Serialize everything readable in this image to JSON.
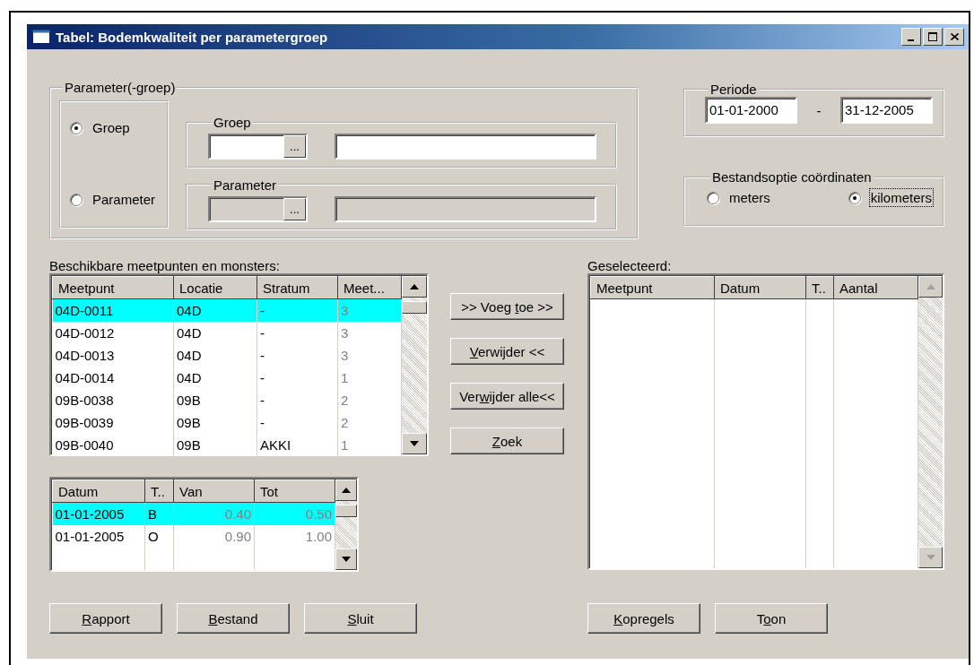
{
  "window": {
    "title": "Tabel: Bodemkwaliteit per parametergroep"
  },
  "parameter_group": {
    "label": "Parameter(-groep)",
    "options": [
      {
        "label": "Groep",
        "selected": true
      },
      {
        "label": "Parameter",
        "selected": false
      }
    ],
    "groups": [
      {
        "label": "Groep",
        "disabled": false,
        "browse_button": "..."
      },
      {
        "label": "Parameter",
        "disabled": true,
        "browse_button": "..."
      }
    ]
  },
  "period": {
    "label": "Periode",
    "from": "01-01-2000",
    "separator": "-",
    "to": "31-12-2005"
  },
  "coordinates": {
    "label": "Bestandsoptie coördinaten",
    "options": [
      {
        "label": "meters",
        "selected": false,
        "focused": false
      },
      {
        "label": "kilometers",
        "selected": true,
        "focused": true
      }
    ]
  },
  "available": {
    "label": "Beschikbare meetpunten en monsters:",
    "scroll_enabled": true,
    "columns": [
      {
        "label": "Meetpunt",
        "kind": "text"
      },
      {
        "label": "Locatie",
        "kind": "text"
      },
      {
        "label": "Stratum",
        "kind": "text"
      },
      {
        "label": "Meet...",
        "kind": "count"
      }
    ],
    "rows": [
      {
        "cells": [
          "04D-0011",
          "04D",
          "-",
          "3"
        ],
        "selected": true
      },
      {
        "cells": [
          "04D-0012",
          "04D",
          "-",
          "3"
        ],
        "selected": false
      },
      {
        "cells": [
          "04D-0013",
          "04D",
          "-",
          "3"
        ],
        "selected": false
      },
      {
        "cells": [
          "04D-0014",
          "04D",
          "-",
          "1"
        ],
        "selected": false
      },
      {
        "cells": [
          "09B-0038",
          "09B",
          "-",
          "2"
        ],
        "selected": false
      },
      {
        "cells": [
          "09B-0039",
          "09B",
          "-",
          "2"
        ],
        "selected": false
      },
      {
        "cells": [
          "09B-0040",
          "09B",
          "AKKI",
          "1"
        ],
        "selected": false
      }
    ]
  },
  "transfer_buttons": [
    {
      "before": ">> Voeg ",
      "access_key": "t",
      "after": "oe >>"
    },
    {
      "access_key": "V",
      "after": "erwijder <<"
    },
    {
      "before": "Ver",
      "access_key": "w",
      "after": "ijder alle<<"
    },
    {
      "access_key": "Z",
      "after": "oek"
    }
  ],
  "samples": {
    "scroll_enabled": true,
    "columns": [
      {
        "label": "Datum",
        "kind": "text"
      },
      {
        "label": "T..",
        "kind": "text"
      },
      {
        "label": "Van",
        "kind": "depth"
      },
      {
        "label": "Tot",
        "kind": "depth"
      }
    ],
    "rows": [
      {
        "cells": [
          "01-01-2005",
          "B",
          "0.40",
          "0.50"
        ],
        "selected": true
      },
      {
        "cells": [
          "01-01-2005",
          "O",
          "0.90",
          "1.00"
        ],
        "selected": false
      }
    ]
  },
  "bottom_buttons": [
    {
      "access_key": "R",
      "after": "apport"
    },
    {
      "access_key": "B",
      "after": "estand"
    },
    {
      "access_key": "S",
      "after": "luit"
    }
  ],
  "selected_list": {
    "label": "Geselecteerd:",
    "scroll_enabled": false,
    "columns": [
      {
        "label": "Meetpunt"
      },
      {
        "label": "Datum"
      },
      {
        "label": "T.."
      },
      {
        "label": "Aantal"
      }
    ]
  },
  "right_buttons": [
    {
      "access_key": "K",
      "after": "opregels"
    },
    {
      "before": "T",
      "access_key": "o",
      "after": "on"
    }
  ]
}
